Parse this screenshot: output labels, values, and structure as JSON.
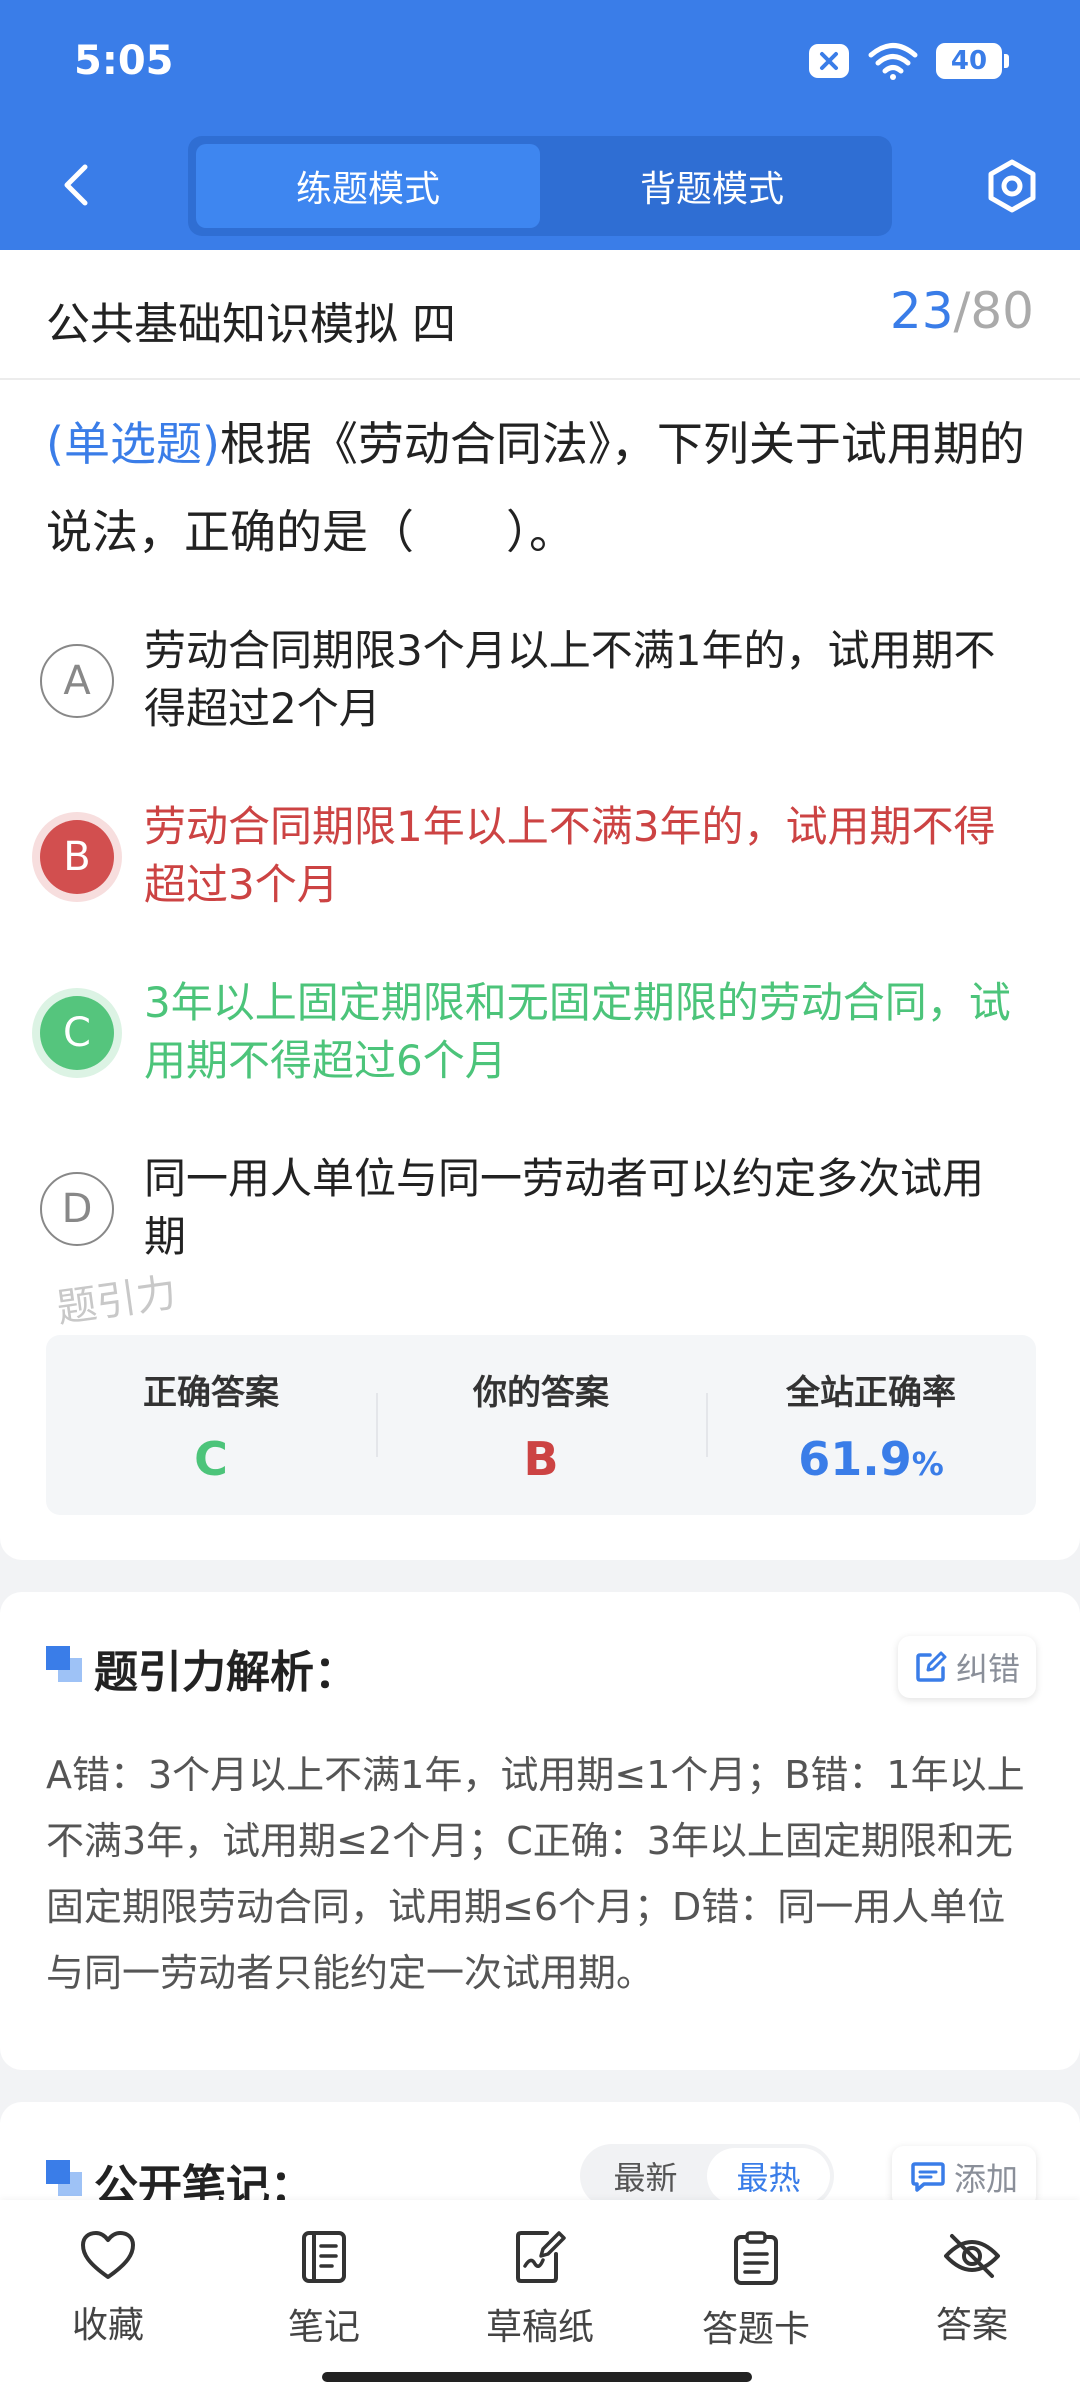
{
  "status_bar": {
    "time": "5:05",
    "battery": "40"
  },
  "nav": {
    "modes": [
      {
        "label": "练题模式",
        "active": true
      },
      {
        "label": "背题模式",
        "active": false
      }
    ]
  },
  "paper": {
    "title": "公共基础知识模拟 四",
    "current": "23",
    "separator": "/",
    "total": "80"
  },
  "question": {
    "type_label": "(单选题)",
    "text": "根据《劳动合同法》，下列关于试用期的说法，正确的是（　　）。"
  },
  "options": [
    {
      "letter": "A",
      "text": "劳动合同期限3个月以上不满1年的，试用期不得超过2个月",
      "state": "normal"
    },
    {
      "letter": "B",
      "text": "劳动合同期限1年以上不满3年的，试用期不得超过3个月",
      "state": "wrong"
    },
    {
      "letter": "C",
      "text": "3年以上固定期限和无固定期限的劳动合同，试用期不得超过6个月",
      "state": "right"
    },
    {
      "letter": "D",
      "text": "同一用人单位与同一劳动者可以约定多次试用期",
      "state": "normal"
    }
  ],
  "watermark": "题引力",
  "answer_summary": {
    "correct_label": "正确答案",
    "correct_value": "C",
    "yours_label": "你的答案",
    "yours_value": "B",
    "rate_label": "全站正确率",
    "rate_value": "61.9",
    "rate_unit": "%"
  },
  "analysis": {
    "title": "题引力解析：",
    "report_label": "纠错",
    "text": "A错：3个月以上不满1年，试用期≤1个月；B错：1年以上不满3年，试用期≤2个月；C正确：3年以上固定期限和无固定期限劳动合同，试用期≤6个月；D错：同一用人单位与同一劳动者只能约定一次试用期。"
  },
  "notes": {
    "title": "公开笔记：",
    "sort_options": [
      "最新",
      "最热"
    ],
    "sort_active": "最热",
    "add_label": "添加"
  },
  "tabbar": [
    {
      "label": "收藏",
      "icon": "heart-icon"
    },
    {
      "label": "笔记",
      "icon": "notebook-icon"
    },
    {
      "label": "草稿纸",
      "icon": "draft-paper-icon"
    },
    {
      "label": "答题卡",
      "icon": "answer-sheet-icon"
    },
    {
      "label": "答案",
      "icon": "eye-off-icon"
    }
  ],
  "colors": {
    "primary": "#3a7de8",
    "wrong": "#cc4343",
    "right": "#4cc47a"
  }
}
